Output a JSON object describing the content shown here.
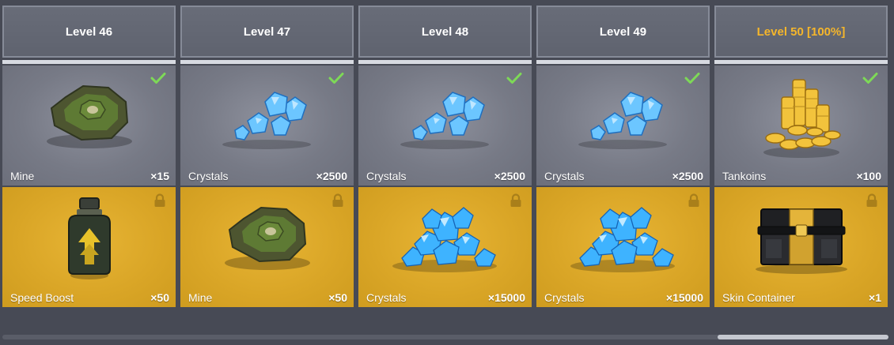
{
  "tiers": [
    {
      "level": "Level 46",
      "highlight": false,
      "free": {
        "name": "Mine",
        "qty": "×15",
        "icon": "mine-icon",
        "claimed": true
      },
      "premium": {
        "name": "Speed Boost",
        "qty": "×50",
        "icon": "speed-boost-icon",
        "locked": true
      }
    },
    {
      "level": "Level 47",
      "highlight": false,
      "free": {
        "name": "Crystals",
        "qty": "×2500",
        "icon": "crystals-small-icon",
        "claimed": true
      },
      "premium": {
        "name": "Mine",
        "qty": "×50",
        "icon": "mine-icon",
        "locked": true
      }
    },
    {
      "level": "Level 48",
      "highlight": false,
      "free": {
        "name": "Crystals",
        "qty": "×2500",
        "icon": "crystals-small-icon",
        "claimed": true
      },
      "premium": {
        "name": "Crystals",
        "qty": "×15000",
        "icon": "crystals-pile-icon",
        "locked": true
      }
    },
    {
      "level": "Level 49",
      "highlight": false,
      "free": {
        "name": "Crystals",
        "qty": "×2500",
        "icon": "crystals-small-icon",
        "claimed": true
      },
      "premium": {
        "name": "Crystals",
        "qty": "×15000",
        "icon": "crystals-pile-icon",
        "locked": true
      }
    },
    {
      "level": "Level 50 [100%]",
      "highlight": true,
      "free": {
        "name": "Tankoins",
        "qty": "×100",
        "icon": "tankoins-icon",
        "claimed": true
      },
      "premium": {
        "name": "Skin Container",
        "qty": "×1",
        "icon": "skin-container-icon",
        "locked": true
      }
    }
  ],
  "colors": {
    "highlight": "#f5b62b",
    "check": "#7ed957",
    "premium_bg": "#d9a526",
    "free_bg": "#7a7d89"
  }
}
